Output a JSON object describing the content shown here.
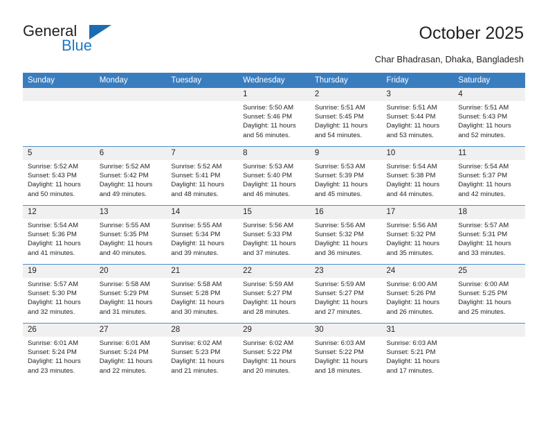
{
  "brand": {
    "name_top": "General",
    "name_bottom": "Blue",
    "accent_color": "#2079c4",
    "triangle_color": "#1b6cb3"
  },
  "header": {
    "title": "October 2025",
    "subtitle": "Char Bhadrasan, Dhaka, Bangladesh"
  },
  "calendar": {
    "header_bg": "#3a7dbf",
    "daynum_bg": "#f0f0f0",
    "weekday_headers": [
      "Sunday",
      "Monday",
      "Tuesday",
      "Wednesday",
      "Thursday",
      "Friday",
      "Saturday"
    ],
    "weeks": [
      [
        {
          "day": "",
          "lines": []
        },
        {
          "day": "",
          "lines": []
        },
        {
          "day": "",
          "lines": []
        },
        {
          "day": "1",
          "lines": [
            "Sunrise: 5:50 AM",
            "Sunset: 5:46 PM",
            "Daylight: 11 hours",
            "and 56 minutes."
          ]
        },
        {
          "day": "2",
          "lines": [
            "Sunrise: 5:51 AM",
            "Sunset: 5:45 PM",
            "Daylight: 11 hours",
            "and 54 minutes."
          ]
        },
        {
          "day": "3",
          "lines": [
            "Sunrise: 5:51 AM",
            "Sunset: 5:44 PM",
            "Daylight: 11 hours",
            "and 53 minutes."
          ]
        },
        {
          "day": "4",
          "lines": [
            "Sunrise: 5:51 AM",
            "Sunset: 5:43 PM",
            "Daylight: 11 hours",
            "and 52 minutes."
          ]
        }
      ],
      [
        {
          "day": "5",
          "lines": [
            "Sunrise: 5:52 AM",
            "Sunset: 5:43 PM",
            "Daylight: 11 hours",
            "and 50 minutes."
          ]
        },
        {
          "day": "6",
          "lines": [
            "Sunrise: 5:52 AM",
            "Sunset: 5:42 PM",
            "Daylight: 11 hours",
            "and 49 minutes."
          ]
        },
        {
          "day": "7",
          "lines": [
            "Sunrise: 5:52 AM",
            "Sunset: 5:41 PM",
            "Daylight: 11 hours",
            "and 48 minutes."
          ]
        },
        {
          "day": "8",
          "lines": [
            "Sunrise: 5:53 AM",
            "Sunset: 5:40 PM",
            "Daylight: 11 hours",
            "and 46 minutes."
          ]
        },
        {
          "day": "9",
          "lines": [
            "Sunrise: 5:53 AM",
            "Sunset: 5:39 PM",
            "Daylight: 11 hours",
            "and 45 minutes."
          ]
        },
        {
          "day": "10",
          "lines": [
            "Sunrise: 5:54 AM",
            "Sunset: 5:38 PM",
            "Daylight: 11 hours",
            "and 44 minutes."
          ]
        },
        {
          "day": "11",
          "lines": [
            "Sunrise: 5:54 AM",
            "Sunset: 5:37 PM",
            "Daylight: 11 hours",
            "and 42 minutes."
          ]
        }
      ],
      [
        {
          "day": "12",
          "lines": [
            "Sunrise: 5:54 AM",
            "Sunset: 5:36 PM",
            "Daylight: 11 hours",
            "and 41 minutes."
          ]
        },
        {
          "day": "13",
          "lines": [
            "Sunrise: 5:55 AM",
            "Sunset: 5:35 PM",
            "Daylight: 11 hours",
            "and 40 minutes."
          ]
        },
        {
          "day": "14",
          "lines": [
            "Sunrise: 5:55 AM",
            "Sunset: 5:34 PM",
            "Daylight: 11 hours",
            "and 39 minutes."
          ]
        },
        {
          "day": "15",
          "lines": [
            "Sunrise: 5:56 AM",
            "Sunset: 5:33 PM",
            "Daylight: 11 hours",
            "and 37 minutes."
          ]
        },
        {
          "day": "16",
          "lines": [
            "Sunrise: 5:56 AM",
            "Sunset: 5:32 PM",
            "Daylight: 11 hours",
            "and 36 minutes."
          ]
        },
        {
          "day": "17",
          "lines": [
            "Sunrise: 5:56 AM",
            "Sunset: 5:32 PM",
            "Daylight: 11 hours",
            "and 35 minutes."
          ]
        },
        {
          "day": "18",
          "lines": [
            "Sunrise: 5:57 AM",
            "Sunset: 5:31 PM",
            "Daylight: 11 hours",
            "and 33 minutes."
          ]
        }
      ],
      [
        {
          "day": "19",
          "lines": [
            "Sunrise: 5:57 AM",
            "Sunset: 5:30 PM",
            "Daylight: 11 hours",
            "and 32 minutes."
          ]
        },
        {
          "day": "20",
          "lines": [
            "Sunrise: 5:58 AM",
            "Sunset: 5:29 PM",
            "Daylight: 11 hours",
            "and 31 minutes."
          ]
        },
        {
          "day": "21",
          "lines": [
            "Sunrise: 5:58 AM",
            "Sunset: 5:28 PM",
            "Daylight: 11 hours",
            "and 30 minutes."
          ]
        },
        {
          "day": "22",
          "lines": [
            "Sunrise: 5:59 AM",
            "Sunset: 5:27 PM",
            "Daylight: 11 hours",
            "and 28 minutes."
          ]
        },
        {
          "day": "23",
          "lines": [
            "Sunrise: 5:59 AM",
            "Sunset: 5:27 PM",
            "Daylight: 11 hours",
            "and 27 minutes."
          ]
        },
        {
          "day": "24",
          "lines": [
            "Sunrise: 6:00 AM",
            "Sunset: 5:26 PM",
            "Daylight: 11 hours",
            "and 26 minutes."
          ]
        },
        {
          "day": "25",
          "lines": [
            "Sunrise: 6:00 AM",
            "Sunset: 5:25 PM",
            "Daylight: 11 hours",
            "and 25 minutes."
          ]
        }
      ],
      [
        {
          "day": "26",
          "lines": [
            "Sunrise: 6:01 AM",
            "Sunset: 5:24 PM",
            "Daylight: 11 hours",
            "and 23 minutes."
          ]
        },
        {
          "day": "27",
          "lines": [
            "Sunrise: 6:01 AM",
            "Sunset: 5:24 PM",
            "Daylight: 11 hours",
            "and 22 minutes."
          ]
        },
        {
          "day": "28",
          "lines": [
            "Sunrise: 6:02 AM",
            "Sunset: 5:23 PM",
            "Daylight: 11 hours",
            "and 21 minutes."
          ]
        },
        {
          "day": "29",
          "lines": [
            "Sunrise: 6:02 AM",
            "Sunset: 5:22 PM",
            "Daylight: 11 hours",
            "and 20 minutes."
          ]
        },
        {
          "day": "30",
          "lines": [
            "Sunrise: 6:03 AM",
            "Sunset: 5:22 PM",
            "Daylight: 11 hours",
            "and 18 minutes."
          ]
        },
        {
          "day": "31",
          "lines": [
            "Sunrise: 6:03 AM",
            "Sunset: 5:21 PM",
            "Daylight: 11 hours",
            "and 17 minutes."
          ]
        },
        {
          "day": "",
          "lines": []
        }
      ]
    ]
  }
}
